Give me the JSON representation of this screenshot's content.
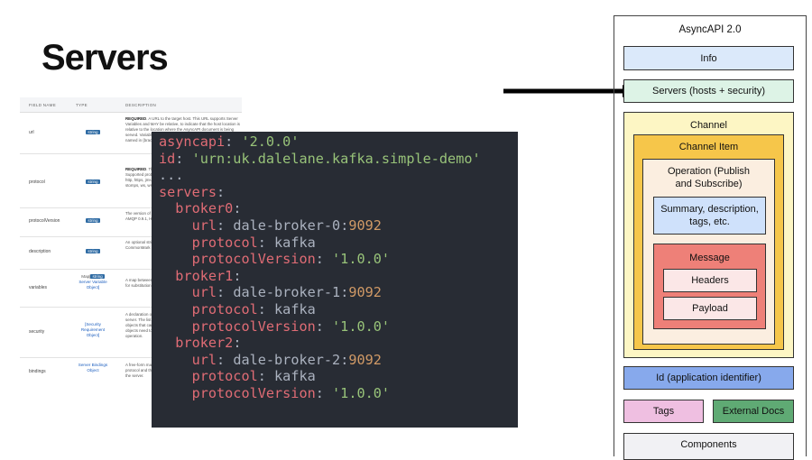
{
  "slide_title": "Servers",
  "spec_table": {
    "headers": [
      "FIELD NAME",
      "TYPE",
      "DESCRIPTION"
    ],
    "rows": [
      {
        "field": "url",
        "type": "string",
        "type_extra": "",
        "desc_bold": "REQUIRED",
        "desc": ". A URL to the target host. This URL supports Server Variables and MAY be relative, to indicate that the host location is relative to the location where the AsyncAPI document is being served. Variable substitutions will be made when a variable is named in {braces}."
      },
      {
        "field": "protocol",
        "type": "string",
        "type_extra": "",
        "desc_bold": "REQUIRED",
        "desc": ". The protocol this URL supports for connection. Supported protocol include, but are not limited to: amqp, amqps, http, https, jms, kafka, kafka-secure, mqtt, secure-mqtt, stomp, stomps, ws, wss."
      },
      {
        "field": "protocolVersion",
        "type": "string",
        "type_extra": "",
        "desc_bold": "",
        "desc": "The version of the protocol used for connection. For instance: AMQP 0.9.1, HTTP 2.0, Kafka 1.0.0, etc."
      },
      {
        "field": "description",
        "type": "string",
        "type_extra": "",
        "desc_bold": "",
        "desc": "An optional string describing the host designated by the URL. CommonMark syntax MAY be used for rich text representation."
      },
      {
        "field": "variables",
        "type": "string",
        "type_prefix": "Map[",
        "type_extra": "Server Variable Object]",
        "desc_bold": "",
        "desc": "A map between a variable name and its value. The value is used for substitution in the server's URL template."
      },
      {
        "field": "security",
        "type": "",
        "type_extra": "[Security Requirement Object]",
        "desc_bold": "",
        "desc": "A declaration of which security mechanisms can be used with this server. The list of values includes alternative security requirement objects that can be used. Only one of the security requirement objects need to be satisfied to authorize a connection or operation."
      },
      {
        "field": "bindings",
        "type": "",
        "type_extra": "Server Bindings Object",
        "desc_bold": "",
        "desc": "A free-form map where the keys describe the name of the protocol and the values describe protocol-specific definitions for the server."
      }
    ]
  },
  "code": {
    "l1_key": "asyncapi",
    "l1_val": "'2.0.0'",
    "l2_key": "id",
    "l2_val": "'urn:uk.dalelane.kafka.simple-demo'",
    "l3": "...",
    "l4_key": "servers",
    "brokers": [
      {
        "name": "broker0",
        "url_host": "dale-broker-0",
        "url_port": "9092",
        "protocol": "kafka",
        "protocolVersion": "'1.0.0'"
      },
      {
        "name": "broker1",
        "url_host": "dale-broker-1",
        "url_port": "9092",
        "protocol": "kafka",
        "protocolVersion": "'1.0.0'"
      },
      {
        "name": "broker2",
        "url_host": "dale-broker-2",
        "url_port": "9092",
        "protocol": "kafka",
        "protocolVersion": "'1.0.0'"
      }
    ],
    "k_url": "url",
    "k_protocol": "protocol",
    "k_protocolVersion": "protocolVersion"
  },
  "diagram": {
    "title": "AsyncAPI 2.0",
    "info": "Info",
    "servers": "Servers (hosts + security)",
    "channel": "Channel",
    "channel_item": "Channel Item",
    "operation": "Operation (Publish and Subscribe)",
    "summary": "Summary, description, tags, etc.",
    "message": "Message",
    "headers": "Headers",
    "payload": "Payload",
    "id": "Id (application identifier)",
    "tags": "Tags",
    "external_docs": "External Docs",
    "components": "Components",
    "colors": {
      "info": "#dbe9fa",
      "servers": "#ddf3e6",
      "channel": "#fdf6c4",
      "channel_item": "#f6c64a",
      "operation": "#fbeee0",
      "summary": "#cfe1fb",
      "message": "#ee8078",
      "inner": "#fbe7e7",
      "id": "#87a9ec",
      "tags": "#efbfe1",
      "external_docs": "#5faa74",
      "components": "#f1f1f4"
    }
  }
}
